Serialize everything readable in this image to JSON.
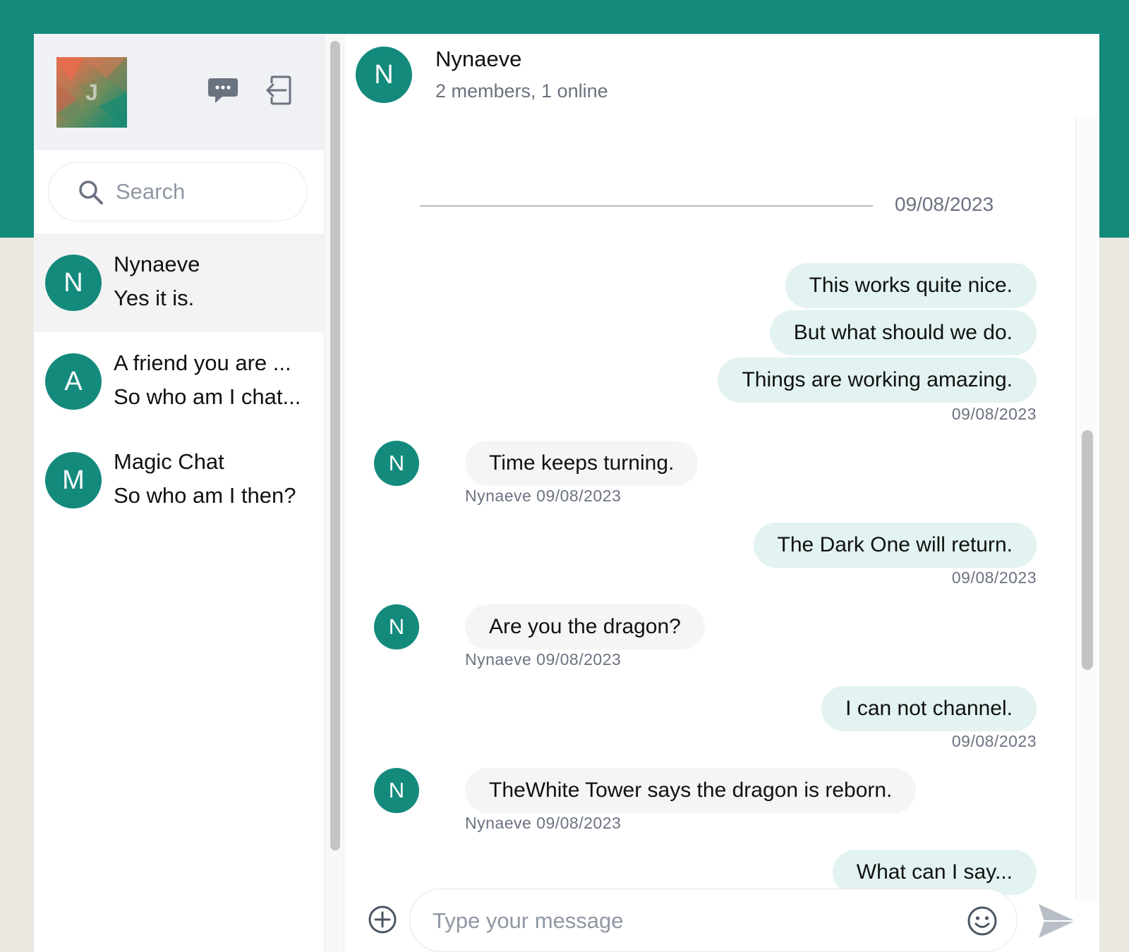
{
  "sidebar": {
    "user": {
      "avatar_letter": "J"
    },
    "icons": {
      "new_chat": "chat-bubble-icon",
      "logout": "logout-icon"
    },
    "search": {
      "placeholder": "Search",
      "icon": "search-icon"
    },
    "conversations": [
      {
        "letter": "N",
        "name": "Nynaeve",
        "last_message": "Yes it is.",
        "active": true
      },
      {
        "letter": "A",
        "name": "A friend you are ...",
        "last_message": "So who am I chat...",
        "active": false
      },
      {
        "letter": "M",
        "name": "Magic Chat",
        "last_message": "So who am I then?",
        "active": false
      }
    ]
  },
  "chat": {
    "header": {
      "letter": "N",
      "title": "Nynaeve",
      "subtitle": "2 members, 1 online"
    },
    "date_separator": "09/08/2023",
    "messages": [
      {
        "direction": "out",
        "text": "This works quite nice."
      },
      {
        "direction": "out",
        "text": "But what should we do."
      },
      {
        "direction": "out",
        "text": "Things are working amazing.",
        "meta": "09/08/2023"
      },
      {
        "direction": "in",
        "avatar": "N",
        "text": "Time keeps turning.",
        "meta": "Nynaeve 09/08/2023"
      },
      {
        "direction": "out",
        "text": "The Dark One will return.",
        "meta": "09/08/2023"
      },
      {
        "direction": "in",
        "avatar": "N",
        "text": "Are you the dragon?",
        "meta": "Nynaeve 09/08/2023"
      },
      {
        "direction": "out",
        "text": "I can not channel.",
        "meta": "09/08/2023"
      },
      {
        "direction": "in",
        "avatar": "N",
        "text": "TheWhite Tower says the dragon is reborn.",
        "meta": "Nynaeve 09/08/2023"
      },
      {
        "direction": "out",
        "text": "What can I say..."
      }
    ]
  },
  "composer": {
    "placeholder": "Type your message",
    "icons": {
      "attach": "plus-circle-icon",
      "emoji": "smiley-icon",
      "send": "send-icon"
    }
  },
  "colors": {
    "brand": "#138a7c",
    "outgoing_bubble": "#e2f3f1",
    "incoming_bubble": "#f5f5f5",
    "background": "#ebe7e1"
  }
}
